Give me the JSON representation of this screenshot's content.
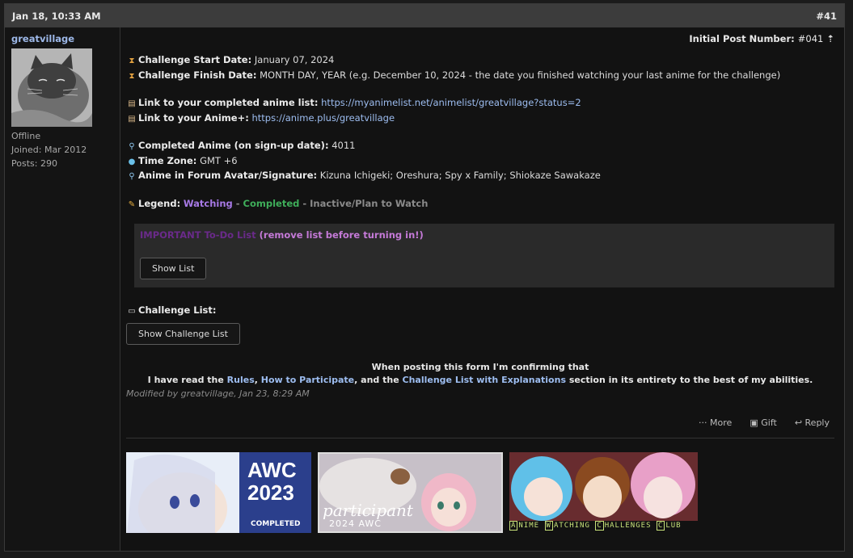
{
  "header": {
    "date": "Jan 18, 10:33 AM",
    "post_number": "#41"
  },
  "user": {
    "name": "greatvillage",
    "status": "Offline",
    "joined": "Joined: Mar 2012",
    "posts": "Posts: 290"
  },
  "post": {
    "initial_label": "Initial Post Number:",
    "initial_value": "#041",
    "start_label": "Challenge Start Date:",
    "start_value": "January 07, 2024",
    "finish_label": "Challenge Finish Date:",
    "finish_value": "MONTH DAY, YEAR (e.g. December 10, 2024 - the date you finished watching your last anime for the challenge)",
    "list_label": "Link to your completed anime list:",
    "list_url": "https://myanimelist.net/animelist/greatvillage?status=2",
    "animeplus_label": "Link to your Anime+:",
    "animeplus_url": "https://anime.plus/greatvillage",
    "completed_label": "Completed Anime (on sign-up date):",
    "completed_value": "4011",
    "tz_label": "Time Zone:",
    "tz_value": "GMT +6",
    "avatar_label": "Anime in Forum Avatar/Signature:",
    "avatar_value": "Kizuna Ichigeki; Oreshura; Spy x Family; Shiokaze Sawakaze",
    "legend_label": "Legend:",
    "legend_watching": "Watching",
    "legend_sep1": " - ",
    "legend_completed": "Completed",
    "legend_sep2": " - ",
    "legend_inactive": "Inactive/Plan to Watch",
    "todo_important": "IMPORTANT To-Do List",
    "todo_remove": "(remove list before turning in!)",
    "show_list": "Show List",
    "challenge_list_label": "Challenge List:",
    "show_challenge_list": "Show Challenge List",
    "confirm_line1": "When posting this form I'm confirming that",
    "confirm_pre": "I have read the ",
    "confirm_rules": "Rules",
    "confirm_comma": ", ",
    "confirm_how": "How to Participate",
    "confirm_and": ", and the ",
    "confirm_cl": "Challenge List with Explanations",
    "confirm_post": " section in its entirety to the best of my abilities.",
    "modified": "Modified by greatvillage, Jan 23, 8:29 AM"
  },
  "actions": {
    "more": "More",
    "gift": "Gift",
    "reply": "Reply"
  },
  "banners": {
    "awc_year": "AWC",
    "awc_num": "2023",
    "awc_completed": "COMPLETED",
    "participant": "participant",
    "participant_year": "2024 AWC",
    "club": [
      {
        "letter": "A",
        "rest": "NIME "
      },
      {
        "letter": "W",
        "rest": "ATCHING "
      },
      {
        "letter": "C",
        "rest": "HALLENGES "
      },
      {
        "letter": "C",
        "rest": "LUB"
      }
    ]
  }
}
